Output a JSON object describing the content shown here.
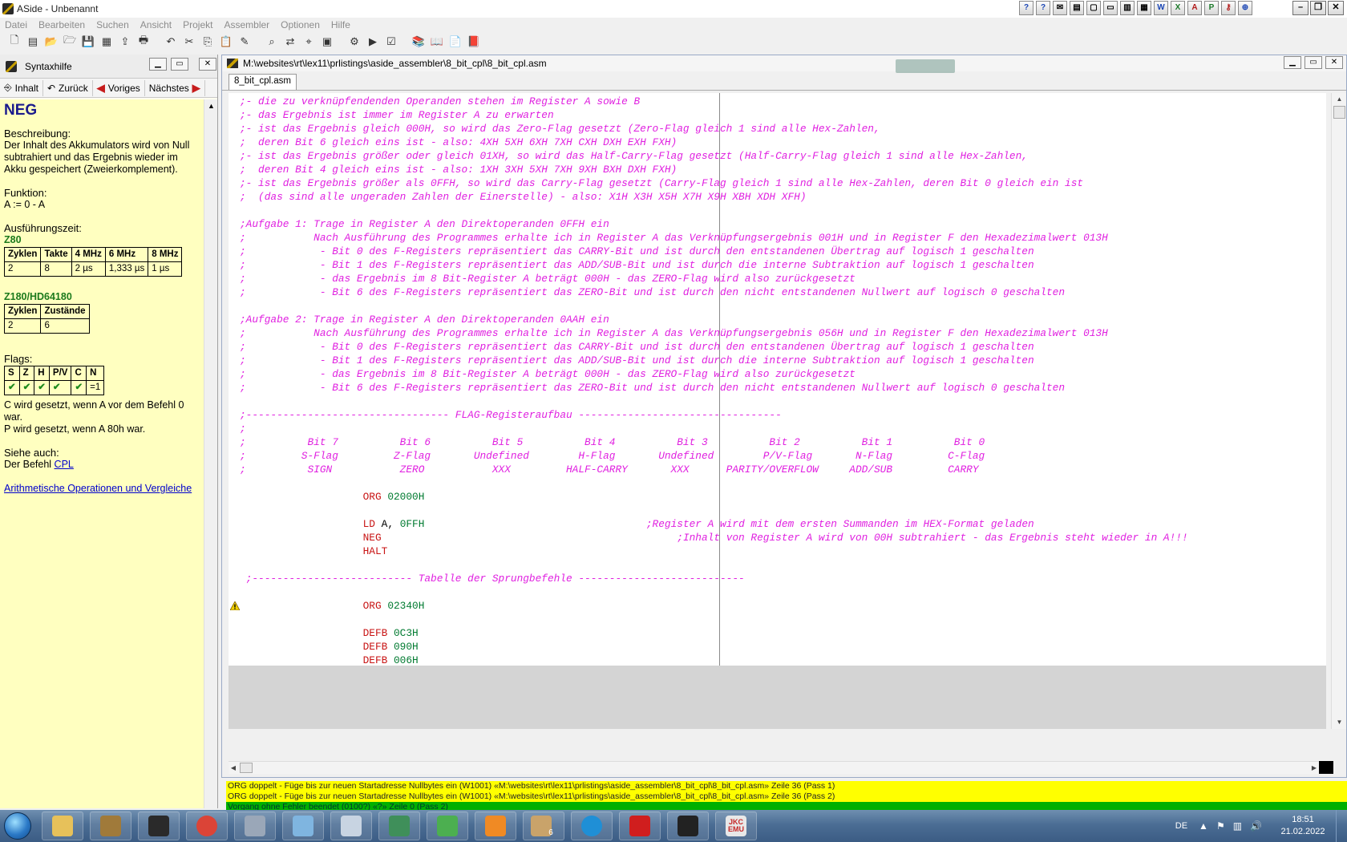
{
  "window": {
    "title": "ASide - Unbenannt"
  },
  "menu": [
    "Datei",
    "Bearbeiten",
    "Suchen",
    "Ansicht",
    "Projekt",
    "Assembler",
    "Optionen",
    "Hilfe"
  ],
  "help": {
    "title": "Syntaxhilfe",
    "nav": {
      "contents": "Inhalt",
      "back": "Zurück",
      "prev": "Voriges",
      "next": "Nächstes"
    },
    "command": "NEG",
    "desc_head": "Beschreibung",
    "desc": "Der Inhalt des Akkumulators wird von Null subtrahiert und das Ergebnis wieder im Akku gespeichert (Zweierkomplement).",
    "func_head": "Funktion",
    "func": "A := 0 - A",
    "time_head": "Ausführungszeit",
    "z80": {
      "label": "Z80",
      "headers": [
        "Zyklen",
        "Takte",
        "4 MHz",
        "6 MHz",
        "8 MHz"
      ],
      "row": [
        "2",
        "8",
        "2 µs",
        "1,333 µs",
        "1 µs"
      ]
    },
    "z180": {
      "label": "Z180/HD64180",
      "headers": [
        "Zyklen",
        "Zustände"
      ],
      "row": [
        "2",
        "6"
      ]
    },
    "flags_head": "Flags",
    "flags": {
      "headers": [
        "S",
        "Z",
        "H",
        "P/V",
        "C",
        "N"
      ],
      "row": [
        "✔",
        "✔",
        "✔",
        "✔",
        "✔",
        "=1"
      ]
    },
    "flag_note_c": "C wird gesetzt, wenn A vor dem Befehl 0 war.",
    "flag_note_p": "P wird gesetzt, wenn A 80h war.",
    "see_head": "Siehe auch",
    "see_prefix": "Der Befehl",
    "see_link": "CPL",
    "link_arith": "Arithmetische Operationen und Vergleiche"
  },
  "editor": {
    "path": "M:\\websites\\rt\\lex11\\prlistings\\aside_assembler\\8_bit_cpl\\8_bit_cpl.asm",
    "tab": "8_bit_cpl.asm",
    "lines": [
      [
        {
          "c": "com",
          "t": ";- die zu verknüpfendenden Operanden stehen im Register A sowie B"
        }
      ],
      [
        {
          "c": "com",
          "t": ";- das Ergebnis ist immer im Register A zu erwarten"
        }
      ],
      [
        {
          "c": "com",
          "t": ";- ist das Ergebnis gleich 000H, so wird das Zero-Flag gesetzt (Zero-Flag gleich 1 sind alle Hex-Zahlen,"
        }
      ],
      [
        {
          "c": "com",
          "t": ";  deren Bit 6 gleich eins ist - also: 4XH 5XH 6XH 7XH CXH DXH EXH FXH)"
        }
      ],
      [
        {
          "c": "com",
          "t": ";- ist das Ergebnis größer oder gleich 01XH, so wird das Half-Carry-Flag gesetzt (Half-Carry-Flag gleich 1 sind alle Hex-Zahlen,"
        }
      ],
      [
        {
          "c": "com",
          "t": ";  deren Bit 4 gleich eins ist - also: 1XH 3XH 5XH 7XH 9XH BXH DXH FXH)"
        }
      ],
      [
        {
          "c": "com",
          "t": ";- ist das Ergebnis größer als 0FFH, so wird das Carry-Flag gesetzt (Carry-Flag gleich 1 sind alle Hex-Zahlen, deren Bit 0 gleich ein ist"
        }
      ],
      [
        {
          "c": "com",
          "t": ";  (das sind alle ungeraden Zahlen der Einerstelle) - also: X1H X3H X5H X7H X9H XBH XDH XFH)"
        }
      ],
      [],
      [
        {
          "c": "com",
          "t": ";Aufgabe 1: Trage in Register A den Direktoperanden 0FFH ein"
        }
      ],
      [
        {
          "c": "com",
          "t": ";           Nach Ausführung des Programmes erhalte ich in Register A das Verknüpfungsergebnis 001H und in Register F den Hexadezimalwert 013H"
        }
      ],
      [
        {
          "c": "com",
          "t": ";            - Bit 0 des F-Registers repräsentiert das CARRY-Bit und ist durch den entstandenen Übertrag auf logisch 1 geschalten"
        }
      ],
      [
        {
          "c": "com",
          "t": ";            - Bit 1 des F-Registers repräsentiert das ADD/SUB-Bit und ist durch die interne Subtraktion auf logisch 1 geschalten"
        }
      ],
      [
        {
          "c": "com",
          "t": ";            - das Ergebnis im 8 Bit-Register A beträgt 000H - das ZERO-Flag wird also zurückgesetzt"
        }
      ],
      [
        {
          "c": "com",
          "t": ";            - Bit 6 des F-Registers repräsentiert das ZERO-Bit und ist durch den nicht entstandenen Nullwert auf logisch 0 geschalten"
        }
      ],
      [],
      [
        {
          "c": "com",
          "t": ";Aufgabe 2: Trage in Register A den Direktoperanden 0AAH ein"
        }
      ],
      [
        {
          "c": "com",
          "t": ";           Nach Ausführung des Programmes erhalte ich in Register A das Verknüpfungsergebnis 056H und in Register F den Hexadezimalwert 013H"
        }
      ],
      [
        {
          "c": "com",
          "t": ";            - Bit 0 des F-Registers repräsentiert das CARRY-Bit und ist durch den entstandenen Übertrag auf logisch 1 geschalten"
        }
      ],
      [
        {
          "c": "com",
          "t": ";            - Bit 1 des F-Registers repräsentiert das ADD/SUB-Bit und ist durch die interne Subtraktion auf logisch 1 geschalten"
        }
      ],
      [
        {
          "c": "com",
          "t": ";            - das Ergebnis im 8 Bit-Register A beträgt 000H - das ZERO-Flag wird also zurückgesetzt"
        }
      ],
      [
        {
          "c": "com",
          "t": ";            - Bit 6 des F-Registers repräsentiert das ZERO-Bit und ist durch den nicht entstandenen Nullwert auf logisch 0 geschalten"
        }
      ],
      [],
      [
        {
          "c": "com",
          "t": ";--------------------------------- FLAG-Registeraufbau ---------------------------------"
        }
      ],
      [
        {
          "c": "com",
          "t": ";"
        }
      ],
      [
        {
          "c": "com",
          "t": ";          Bit 7          Bit 6          Bit 5          Bit 4          Bit 3          Bit 2          Bit 1          Bit 0"
        }
      ],
      [
        {
          "c": "com",
          "t": ";         S-Flag         Z-Flag       Undefined        H-Flag       Undefined        P/V-Flag       N-Flag         C-Flag"
        }
      ],
      [
        {
          "c": "com",
          "t": ";          SIGN           ZERO           XXX         HALF-CARRY       XXX      PARITY/OVERFLOW     ADD/SUB         CARRY"
        }
      ],
      [],
      [
        {
          "c": "plain",
          "t": "                    "
        },
        {
          "c": "kw",
          "t": "ORG "
        },
        {
          "c": "num",
          "t": "02000H"
        }
      ],
      [],
      [
        {
          "c": "plain",
          "t": "                    "
        },
        {
          "c": "kw",
          "t": "LD "
        },
        {
          "c": "plain",
          "t": "A, "
        },
        {
          "c": "num",
          "t": "0FFH"
        },
        {
          "c": "plain",
          "t": "                                    "
        },
        {
          "c": "com",
          "t": ";Register A wird mit dem ersten Summanden im HEX-Format geladen"
        }
      ],
      [
        {
          "c": "plain",
          "t": "                    "
        },
        {
          "c": "kw",
          "t": "NEG"
        },
        {
          "c": "plain",
          "t": "                                                "
        },
        {
          "c": "com",
          "t": ";Inhalt von Register A wird von 00H subtrahiert - das Ergebnis steht wieder in A!!!"
        }
      ],
      [
        {
          "c": "plain",
          "t": "                    "
        },
        {
          "c": "kw",
          "t": "HALT"
        }
      ],
      [],
      [
        {
          "c": "com",
          "t": " ;-------------------------- Tabelle der Sprungbefehle ---------------------------"
        }
      ],
      [],
      [
        {
          "c": "plain",
          "t": "                    "
        },
        {
          "c": "kw",
          "t": "ORG "
        },
        {
          "c": "num",
          "t": "02340H"
        }
      ],
      [],
      [
        {
          "c": "plain",
          "t": "                    "
        },
        {
          "c": "kw",
          "t": "DEFB "
        },
        {
          "c": "num",
          "t": "0C3H"
        }
      ],
      [
        {
          "c": "plain",
          "t": "                    "
        },
        {
          "c": "kw",
          "t": "DEFB "
        },
        {
          "c": "num",
          "t": "090H"
        }
      ],
      [
        {
          "c": "plain",
          "t": "                    "
        },
        {
          "c": "kw",
          "t": "DEFB "
        },
        {
          "c": "num",
          "t": "006H"
        }
      ]
    ],
    "warning_line": 37
  },
  "messages": [
    {
      "type": "warn",
      "text": "ORG doppelt - Füge bis zur neuen Startadresse Nullbytes ein (W1001) «M:\\websites\\rt\\lex11\\prlistings\\aside_assembler\\8_bit_cpl\\8_bit_cpl.asm» Zeile 36 (Pass 1)"
    },
    {
      "type": "warn",
      "text": "ORG doppelt - Füge bis zur neuen Startadresse Nullbytes ein (W1001) «M:\\websites\\rt\\lex11\\prlistings\\aside_assembler\\8_bit_cpl\\8_bit_cpl.asm» Zeile 36 (Pass 2)"
    },
    {
      "type": "ok",
      "text": "Vorgang ohne Fehler beendet (0100?) «?» Zeile 0 (Pass 2)"
    }
  ],
  "taskbar": {
    "apps": [
      {
        "name": "file-explorer",
        "color": "#e7c15a"
      },
      {
        "name": "app-compass",
        "color": "#a07a3a"
      },
      {
        "name": "aside-ide",
        "color": "#2a2a2a"
      },
      {
        "name": "chrome",
        "color": "#db4437"
      },
      {
        "name": "app-tool",
        "color": "#9aa7b8"
      },
      {
        "name": "app-notes",
        "color": "#7fb5e0"
      },
      {
        "name": "calculator",
        "color": "#c8d4e2"
      },
      {
        "name": "app-globe",
        "color": "#3f8f5a"
      },
      {
        "name": "app-green",
        "color": "#4caf50"
      },
      {
        "name": "media-player",
        "color": "#f08a24"
      },
      {
        "name": "paint",
        "color": "#c9a36a"
      },
      {
        "name": "edge",
        "color": "#1f8fd6"
      },
      {
        "name": "app-pl",
        "color": "#d01e1e"
      },
      {
        "name": "aside-ide-2",
        "color": "#222222"
      },
      {
        "name": "jkc-emu",
        "color": "#e8e8e8"
      }
    ],
    "paint_badge": "6",
    "jkc_label": "JKC EMU",
    "lang": "DE",
    "time": "18:51",
    "date": "21.02.2022"
  },
  "colors": {
    "comment": "#e020e0",
    "keyword": "#c81414",
    "number": "#007a30",
    "help_bg": "#ffffc0",
    "msg_warn": "#ffff00",
    "msg_ok": "#00b000"
  }
}
